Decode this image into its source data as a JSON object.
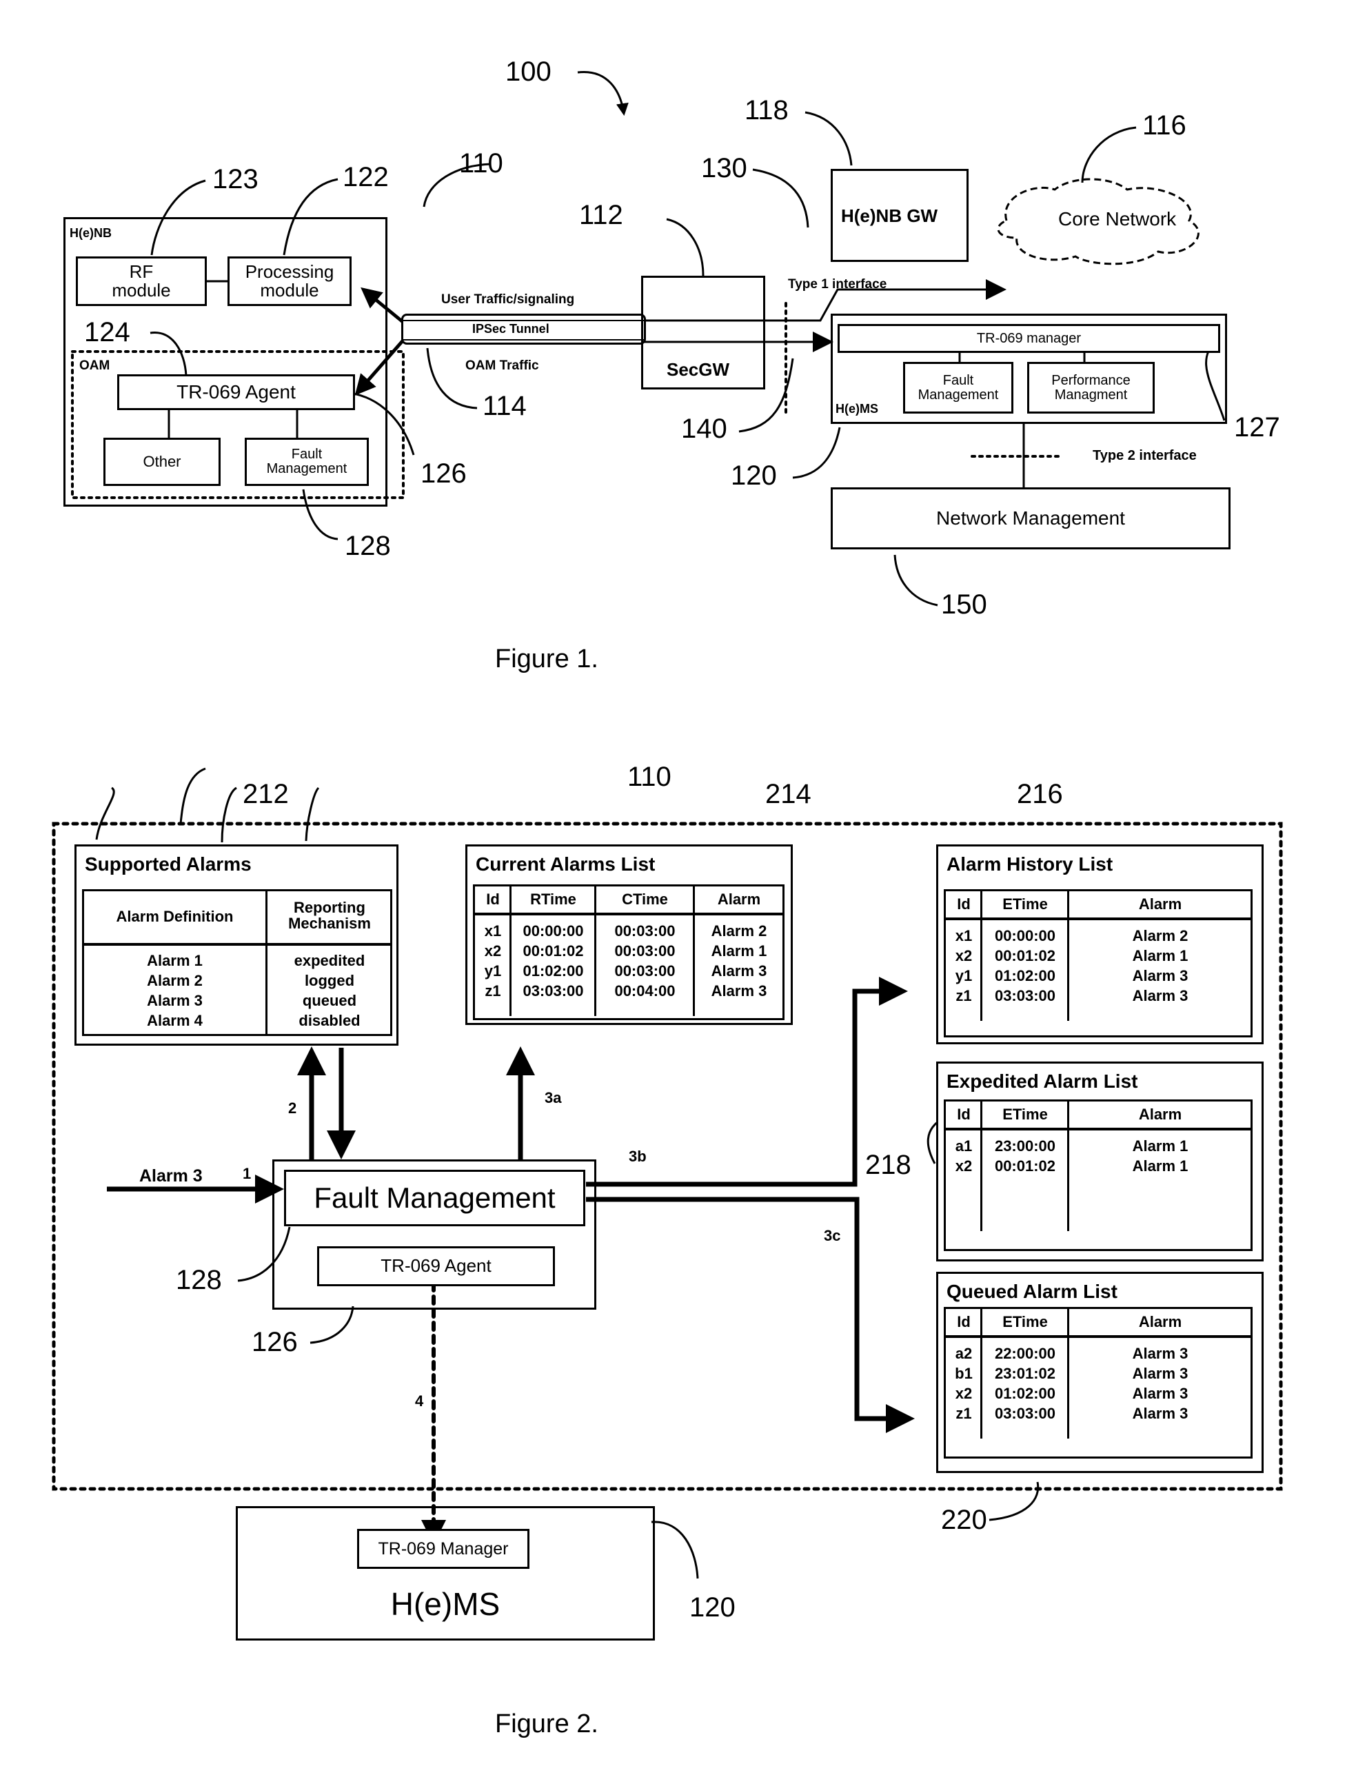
{
  "figure1": {
    "caption": "Figure 1.",
    "refs": {
      "r100": "100",
      "r110": "110",
      "r112": "112",
      "r114": "114",
      "r116": "116",
      "r118": "118",
      "r120": "120",
      "r122": "122",
      "r123": "123",
      "r124": "124",
      "r126": "126",
      "r127": "127",
      "r128": "128",
      "r130": "130",
      "r140": "140",
      "r150": "150"
    },
    "henb": {
      "label": "H(e)NB",
      "rf_module": [
        "RF",
        "module"
      ],
      "processing_module": [
        "Processing",
        "module"
      ],
      "oam_label": "OAM",
      "tr069_agent": "TR-069 Agent",
      "other": "Other",
      "fault_management": [
        "Fault",
        "Management"
      ]
    },
    "tunnel": {
      "user_traffic": "User Traffic/signaling",
      "ipsec_tunnel": "IPSec Tunnel",
      "oam_traffic": "OAM Traffic"
    },
    "secgw": "SecGW",
    "henb_gw": "H(e)NB GW",
    "core_network": "Core Network",
    "type1_interface": "Type 1 interface",
    "type2_interface": "Type 2 interface",
    "hems": {
      "label": "H(e)MS",
      "tr069_manager": "TR-069 manager",
      "fault_management": [
        "Fault",
        "Management"
      ],
      "performance_management": [
        "Performance",
        "Managment"
      ]
    },
    "network_management": "Network Management"
  },
  "figure2": {
    "caption": "Figure 2.",
    "refs": {
      "r110": "110",
      "r212": "212",
      "r214": "214",
      "r216": "216",
      "r218": "218",
      "r220": "220",
      "r128": "128",
      "r126": "126",
      "r120": "120"
    },
    "steps": {
      "s1": "1",
      "s2": "2",
      "s3a": "3a",
      "s3b": "3b",
      "s3c": "3c",
      "s4": "4"
    },
    "incoming_alarm": "Alarm 3",
    "fault_management": "Fault Management",
    "tr069_agent": "TR-069 Agent",
    "tr069_manager": "TR-069 Manager",
    "hems": "H(e)MS",
    "supported_alarms": {
      "title": "Supported Alarms",
      "headers": [
        "Alarm Definition",
        [
          "Reporting",
          "Mechanism"
        ]
      ],
      "rows": [
        [
          "Alarm 1",
          "expedited"
        ],
        [
          "Alarm 2",
          "logged"
        ],
        [
          "Alarm 3",
          "queued"
        ],
        [
          "Alarm 4",
          "disabled"
        ]
      ]
    },
    "current_alarms": {
      "title": "Current Alarms List",
      "headers": [
        "Id",
        "RTime",
        "CTime",
        "Alarm"
      ],
      "rows": [
        [
          "x1",
          "00:00:00",
          "00:03:00",
          "Alarm 2"
        ],
        [
          "x2",
          "00:01:02",
          "00:03:00",
          "Alarm 1"
        ],
        [
          "y1",
          "01:02:00",
          "00:03:00",
          "Alarm 3"
        ],
        [
          "z1",
          "03:03:00",
          "00:04:00",
          "Alarm 3"
        ]
      ]
    },
    "alarm_history": {
      "title": "Alarm History List",
      "headers": [
        "Id",
        "ETime",
        "Alarm"
      ],
      "rows": [
        [
          "x1",
          "00:00:00",
          "Alarm 2"
        ],
        [
          "x2",
          "00:01:02",
          "Alarm 1"
        ],
        [
          "y1",
          "01:02:00",
          "Alarm 3"
        ],
        [
          "z1",
          "03:03:00",
          "Alarm 3"
        ]
      ]
    },
    "expedited_alarms": {
      "title": "Expedited Alarm List",
      "headers": [
        "Id",
        "ETime",
        "Alarm"
      ],
      "rows": [
        [
          "a1",
          "23:00:00",
          "Alarm 1"
        ],
        [
          "x2",
          "00:01:02",
          "Alarm 1"
        ]
      ]
    },
    "queued_alarms": {
      "title": "Queued Alarm List",
      "headers": [
        "Id",
        "ETime",
        "Alarm"
      ],
      "rows": [
        [
          "a2",
          "22:00:00",
          "Alarm 3"
        ],
        [
          "b1",
          "23:01:02",
          "Alarm 3"
        ],
        [
          "x2",
          "01:02:00",
          "Alarm 3"
        ],
        [
          "z1",
          "03:03:00",
          "Alarm 3"
        ]
      ]
    }
  }
}
